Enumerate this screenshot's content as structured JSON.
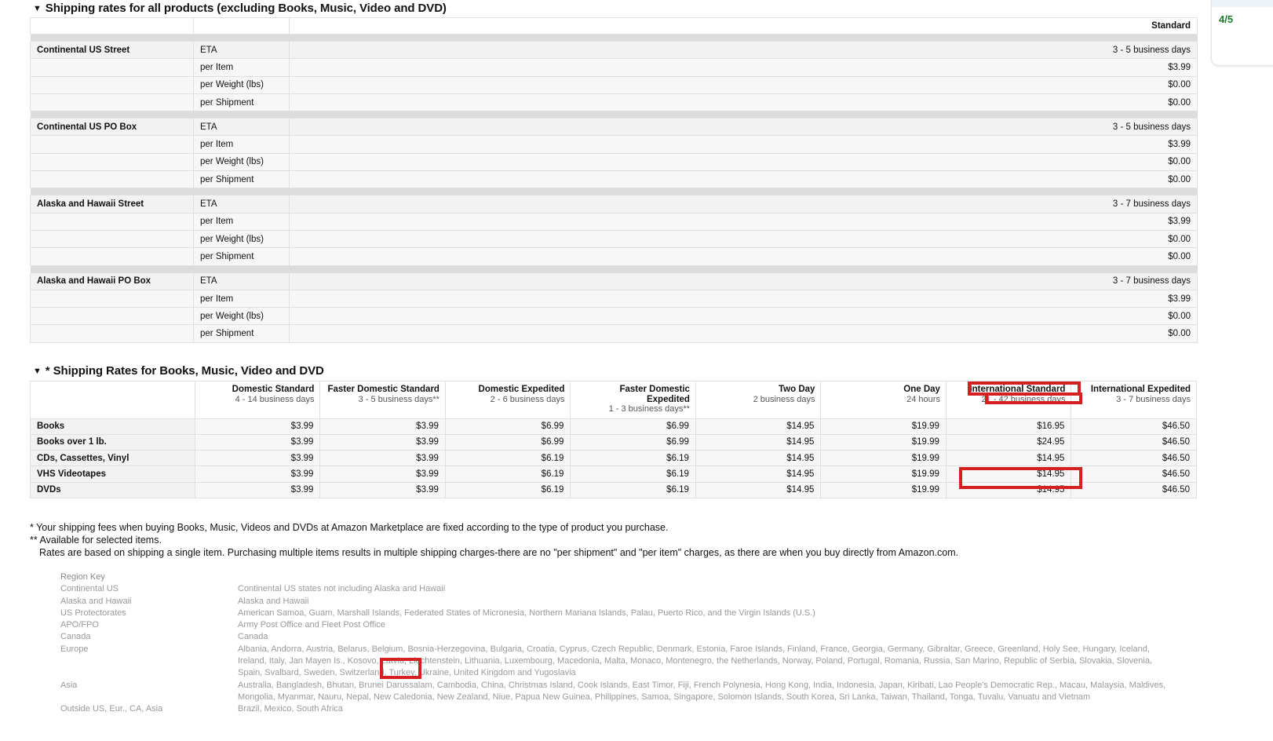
{
  "section1": {
    "title": "Shipping rates for all products (excluding Books, Music, Video and DVD)",
    "caret": "▼",
    "standard_header": "Standard",
    "measures": {
      "eta": "ETA",
      "per_item": "per Item",
      "per_weight": "per Weight (lbs)",
      "per_shipment": "per Shipment"
    },
    "groups": [
      {
        "region": "Continental US Street",
        "eta": "3 - 5 business days",
        "per_item": "$3.99",
        "per_weight": "$0.00",
        "per_shipment": "$0.00"
      },
      {
        "region": "Continental US PO Box",
        "eta": "3 - 5 business days",
        "per_item": "$3.99",
        "per_weight": "$0.00",
        "per_shipment": "$0.00"
      },
      {
        "region": "Alaska and Hawaii Street",
        "eta": "3 - 7 business days",
        "per_item": "$3.99",
        "per_weight": "$0.00",
        "per_shipment": "$0.00"
      },
      {
        "region": "Alaska and Hawaii PO Box",
        "eta": "3 - 7 business days",
        "per_item": "$3.99",
        "per_weight": "$0.00",
        "per_shipment": "$0.00"
      }
    ]
  },
  "section2": {
    "title": "* Shipping Rates for Books, Music, Video and DVD",
    "caret": "▼",
    "columns": [
      {
        "name": "Domestic Standard",
        "eta": "4 - 14 business days"
      },
      {
        "name": "Faster Domestic Standard",
        "eta": "3 - 5 business days**"
      },
      {
        "name": "Domestic Expedited",
        "eta": "2 - 6 business days"
      },
      {
        "name": "Faster Domestic Expedited",
        "eta": "1 - 3 business days**"
      },
      {
        "name": "Two Day",
        "eta": "2 business days"
      },
      {
        "name": "One Day",
        "eta": "24 hours"
      },
      {
        "name": "International Standard",
        "eta": "21 - 42 business days"
      },
      {
        "name": "International Expedited",
        "eta": "3 - 7 business days"
      }
    ],
    "rows": [
      {
        "label": "Books",
        "values": [
          "$3.99",
          "$3.99",
          "$6.99",
          "$6.99",
          "$14.95",
          "$19.99",
          "$16.95",
          "$46.50"
        ]
      },
      {
        "label": "Books over 1 lb.",
        "values": [
          "$3.99",
          "$3.99",
          "$6.99",
          "$6.99",
          "$14.95",
          "$19.99",
          "$24.95",
          "$46.50"
        ]
      },
      {
        "label": "CDs, Cassettes, Vinyl",
        "values": [
          "$3.99",
          "$3.99",
          "$6.19",
          "$6.19",
          "$14.95",
          "$19.99",
          "$14.95",
          "$46.50"
        ]
      },
      {
        "label": "VHS Videotapes",
        "values": [
          "$3.99",
          "$3.99",
          "$6.19",
          "$6.19",
          "$14.95",
          "$19.99",
          "$14.95",
          "$46.50"
        ]
      },
      {
        "label": "DVDs",
        "values": [
          "$3.99",
          "$3.99",
          "$6.19",
          "$6.19",
          "$14.95",
          "$19.99",
          "$14.95",
          "$46.50"
        ]
      }
    ]
  },
  "notes": {
    "line1": "* Your shipping fees when buying Books, Music, Videos and DVDs at Amazon Marketplace are fixed according to the type of product you purchase.",
    "line2": "**  Available for selected items.",
    "line3": "Rates are based on shipping a single item. Purchasing multiple items results in multiple shipping charges-there are no \"per shipment\" and \"per item\" charges, as there are when you buy directly from Amazon.com."
  },
  "region_key": {
    "title": "Region Key",
    "rows": [
      {
        "label": "Continental US",
        "lines": [
          "Continental US states not including Alaska and Hawaii"
        ]
      },
      {
        "label": "Alaska and Hawaii",
        "lines": [
          "Alaska and Hawaii"
        ]
      },
      {
        "label": "US Protectorates",
        "lines": [
          "American Samoa, Guam, Marshall Islands, Federated States of Micronesia, Northern Mariana Islands, Palau, Puerto Rico, and the Virgin Islands (U.S.)"
        ]
      },
      {
        "label": "APO/FPO",
        "lines": [
          "Army Post Office and Fleet Post Office"
        ]
      },
      {
        "label": "Canada",
        "lines": [
          "Canada"
        ]
      },
      {
        "label": "Europe",
        "lines": [
          "Albania, Andorra, Austria, Belarus, Belgium, Bosnia-Herzegovina, Bulgaria, Croatia, Cyprus, Czech Republic, Denmark, Estonia, Faroe Islands, Finland, France, Georgia, Germany, Gibraltar, Greece, Greenland, Holy See, Hungary, Iceland,",
          "Ireland, Italy, Jan Mayen Is., Kosovo, Latvia, Liechtenstein, Lithuania, Luxembourg, Macedonia, Malta, Monaco, Montenegro, the Netherlands, Norway, Poland, Portugal, Romania, Russia, San Marino, Republic of Serbia, Slovakia, Slovenia,",
          "Spain, Svalbard, Sweden, Switzerland, Turkey, Ukraine, United Kingdom and Yugoslavia"
        ]
      },
      {
        "label": "Asia",
        "lines": [
          "Australia, Bangladesh, Bhutan, Brunei Darussalam, Cambodia, China, Christmas Island, Cook Islands, East Timor, Fiji, French Polynesia, Hong Kong, India, Indonesia, Japan, Kiribati, Lao People's Democratic Rep., Macau, Malaysia, Maldives,",
          "Mongolia, Myanmar, Nauru, Nepal, New Caledonia, New Zealand, Niue, Papua New Guinea, Philippines, Samoa, Singapore, Solomon Islands, South Korea, Sri Lanka, Taiwan, Thailand, Tonga, Tuvalu, Vanuatu and Vietnam"
        ]
      },
      {
        "label": "Outside US, Eur., CA, Asia",
        "lines": [
          "Brazil, Mexico, South Africa"
        ]
      }
    ]
  },
  "annotations": {
    "highlight_header": "International Standard",
    "highlight_eta": "21 - 42 business days",
    "highlight_cell": "$14.95",
    "highlight_country": "Turkey,"
  },
  "edge_badge": {
    "score": "4/5"
  }
}
